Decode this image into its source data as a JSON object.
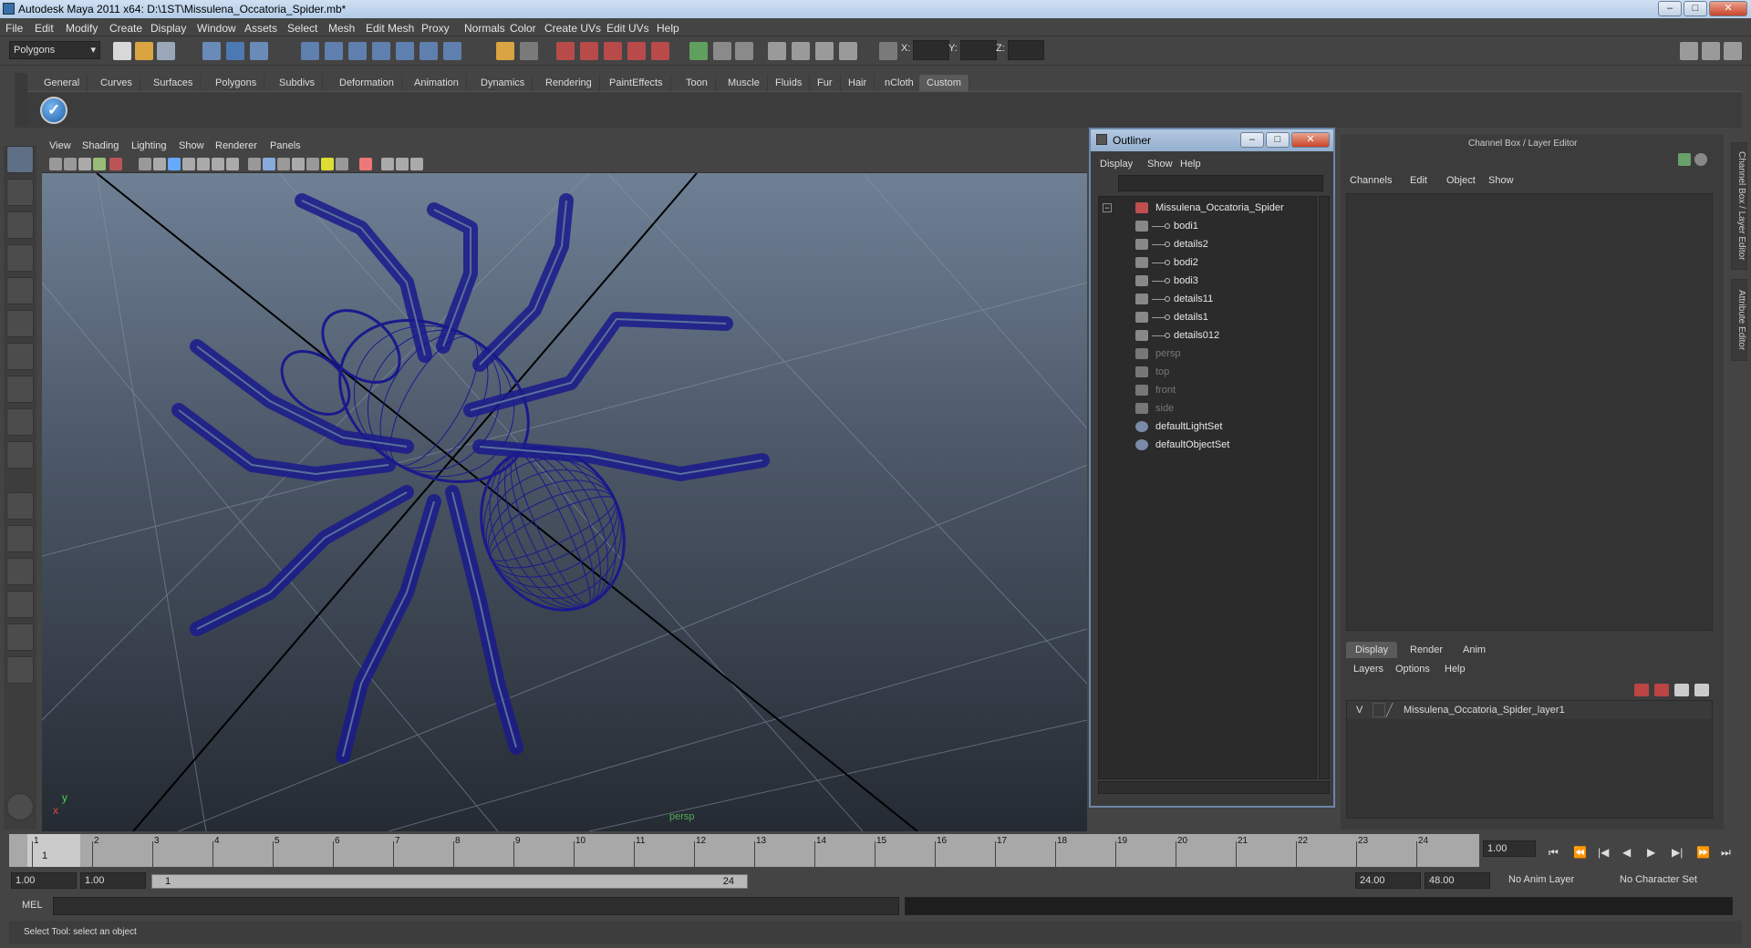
{
  "window": {
    "title": "Autodesk Maya 2011 x64: D:\\1ST\\Missulena_Occatoria_Spider.mb*",
    "minimize": "–",
    "maximize": "□",
    "close": "✕"
  },
  "menubar": [
    "File",
    "Edit",
    "Modify",
    "Create",
    "Display",
    "Window",
    "Assets",
    "Select",
    "Mesh",
    "Edit Mesh",
    "Proxy",
    "Normals",
    "Color",
    "Create UVs",
    "Edit UVs",
    "Help"
  ],
  "statusline": {
    "menuset": "Polygons",
    "x_label": "X:",
    "y_label": "Y:",
    "z_label": "Z:"
  },
  "shelf_tabs": [
    "General",
    "Curves",
    "Surfaces",
    "Polygons",
    "Subdivs",
    "Deformation",
    "Animation",
    "Dynamics",
    "Rendering",
    "PaintEffects",
    "Toon",
    "Muscle",
    "Fluids",
    "Fur",
    "Hair",
    "nCloth",
    "Custom"
  ],
  "shelf_active": "Custom",
  "viewport": {
    "menus": [
      "View",
      "Shading",
      "Lighting",
      "Show",
      "Renderer",
      "Panels"
    ],
    "camera_label": "persp",
    "axis_y": "y",
    "axis_x": "x",
    "wire_color": "#1a1a8c"
  },
  "outliner": {
    "title": "Outliner",
    "menus": [
      "Display",
      "Show",
      "Help"
    ],
    "items": [
      {
        "label": "Missulena_Occatoria_Spider",
        "type": "group",
        "indent": 0,
        "dim": false
      },
      {
        "label": "bodi1",
        "type": "mesh",
        "indent": 1,
        "dim": false
      },
      {
        "label": "details2",
        "type": "mesh",
        "indent": 1,
        "dim": false
      },
      {
        "label": "bodi2",
        "type": "mesh",
        "indent": 1,
        "dim": false
      },
      {
        "label": "bodi3",
        "type": "mesh",
        "indent": 1,
        "dim": false
      },
      {
        "label": "details11",
        "type": "mesh",
        "indent": 1,
        "dim": false
      },
      {
        "label": "details1",
        "type": "mesh",
        "indent": 1,
        "dim": false
      },
      {
        "label": "details012",
        "type": "mesh",
        "indent": 1,
        "dim": false
      },
      {
        "label": "persp",
        "type": "camera",
        "indent": 0,
        "dim": true
      },
      {
        "label": "top",
        "type": "camera",
        "indent": 0,
        "dim": true
      },
      {
        "label": "front",
        "type": "camera",
        "indent": 0,
        "dim": true
      },
      {
        "label": "side",
        "type": "camera",
        "indent": 0,
        "dim": true
      },
      {
        "label": "defaultLightSet",
        "type": "set",
        "indent": 0,
        "dim": false
      },
      {
        "label": "defaultObjectSet",
        "type": "set",
        "indent": 0,
        "dim": false
      }
    ]
  },
  "channelbox": {
    "title": "Channel Box / Layer Editor",
    "menus": [
      "Channels",
      "Edit",
      "Object",
      "Show"
    ],
    "layer_tabs": [
      "Display",
      "Render",
      "Anim"
    ],
    "layer_menus": [
      "Layers",
      "Options",
      "Help"
    ],
    "layer": {
      "visible": "V",
      "name": "Missulena_Occatoria_Spider_layer1"
    },
    "side_tabs": [
      "Channel Box / Layer Editor",
      "Attribute Editor"
    ]
  },
  "timeslider": {
    "ticks": [
      "1",
      "2",
      "3",
      "4",
      "5",
      "6",
      "7",
      "8",
      "9",
      "10",
      "11",
      "12",
      "13",
      "14",
      "15",
      "16",
      "17",
      "18",
      "19",
      "20",
      "21",
      "22",
      "23",
      "24"
    ],
    "current_frame": "1",
    "current_time_field": "1.00",
    "playback": [
      "⏮",
      "⏪",
      "|◀",
      "◀",
      "▶",
      "▶|",
      "⏩",
      "⏭"
    ]
  },
  "rangeslider": {
    "start_time": "1.00",
    "playback_start": "1.00",
    "range_start_label": "1",
    "range_end_label": "24",
    "playback_end": "24.00",
    "end_time": "48.00",
    "anim_layer": "No Anim Layer",
    "character_set": "No Character Set"
  },
  "cmdline": {
    "label": "MEL"
  },
  "helpline": {
    "text": "Select Tool: select an object"
  }
}
